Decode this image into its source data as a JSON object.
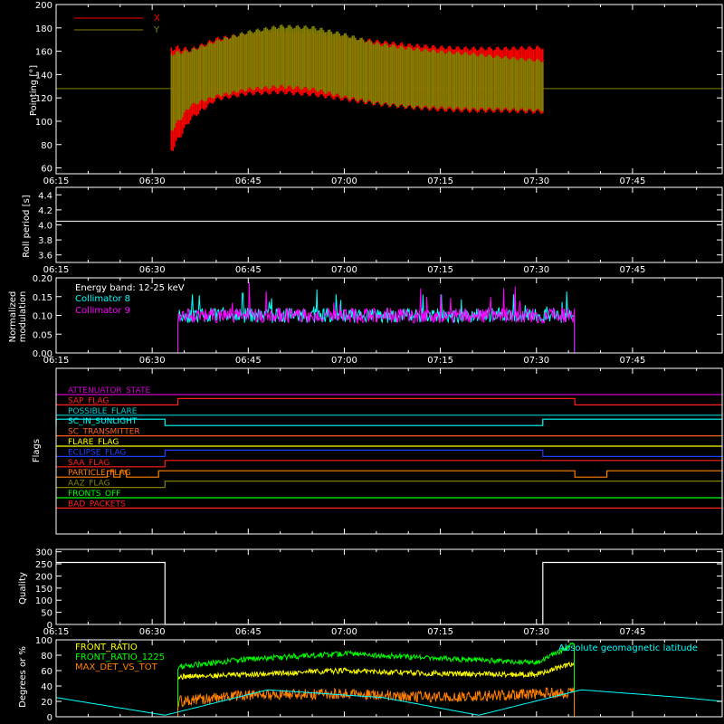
{
  "panels": {
    "pointing": {
      "ylabel": "Pointing [°]",
      "legend": [
        {
          "label": "X",
          "color": "#ff0000"
        },
        {
          "label": "Y",
          "color": "#808000"
        }
      ]
    },
    "roll": {
      "ylabel": "Roll period [s]"
    },
    "modulation": {
      "ylabel_lines": [
        "Normalized",
        "modulation"
      ],
      "annotations": [
        "Energy band: 12-25 keV"
      ],
      "legend": [
        {
          "label": "Collimator 8",
          "color": "#00ffff"
        },
        {
          "label": "Collimator 9",
          "color": "#ff00ff"
        }
      ]
    },
    "flags": {
      "ylabel": "Flags"
    },
    "quality": {
      "ylabel": "Quality"
    },
    "ratios": {
      "ylabel": "Degrees or %",
      "legend": [
        {
          "label": "FRONT_RATIO",
          "color": "#ffff00"
        },
        {
          "label": "FRONT_RATIO_1225",
          "color": "#00ff00"
        },
        {
          "label": "MAX_DET_VS_TOT",
          "color": "#ff8000"
        }
      ],
      "annotation": {
        "label": "Absolute geomagnetic latitude",
        "color": "#00ffff"
      }
    }
  },
  "chart_data": [
    {
      "type": "line",
      "id": "pointing",
      "ylabel": "Pointing [°]",
      "x_range": [
        "06:15",
        "07:59"
      ],
      "x_ticks": [
        "06:15",
        "06:30",
        "06:45",
        "07:00",
        "07:15",
        "07:30",
        "07:45"
      ],
      "ylim": [
        55,
        200
      ],
      "y_ticks": [
        60,
        80,
        100,
        120,
        140,
        160,
        180,
        200
      ],
      "baseline": 128,
      "data_window": [
        "06:33",
        "07:31"
      ],
      "series": [
        {
          "name": "X",
          "color": "#ff0000",
          "envelope_x": [
            "06:33",
            "06:36",
            "06:40",
            "06:45",
            "06:50",
            "06:55",
            "07:00",
            "07:05",
            "07:10",
            "07:15",
            "07:20",
            "07:25",
            "07:31"
          ],
          "envelope_max": [
            166,
            163,
            172,
            177,
            179,
            178,
            174,
            170,
            167,
            165,
            164,
            164,
            165
          ],
          "envelope_min": [
            72,
            100,
            117,
            122,
            123,
            121,
            117,
            113,
            110,
            108,
            107,
            107,
            106
          ]
        },
        {
          "name": "Y",
          "color": "#808000",
          "envelope_x": [
            "06:33",
            "06:36",
            "06:40",
            "06:45",
            "06:50",
            "06:55",
            "07:00",
            "07:05",
            "07:10",
            "07:15",
            "07:20",
            "07:25",
            "07:31"
          ],
          "envelope_max": [
            160,
            162,
            170,
            178,
            183,
            182,
            176,
            168,
            164,
            161,
            159,
            156,
            153
          ],
          "envelope_min": [
            90,
            112,
            120,
            126,
            128,
            126,
            119,
            114,
            111,
            110,
            109,
            109,
            108
          ]
        }
      ]
    },
    {
      "type": "line",
      "id": "roll",
      "ylabel": "Roll period [s]",
      "x_range": [
        "06:15",
        "07:59"
      ],
      "ylim": [
        3.5,
        4.5
      ],
      "y_ticks": [
        3.6,
        3.8,
        4.0,
        4.2,
        4.4
      ],
      "series": [
        {
          "color": "#ffffff",
          "x": [
            "06:15",
            "07:59"
          ],
          "y": [
            4.05,
            4.05
          ]
        }
      ]
    },
    {
      "type": "line",
      "id": "modulation",
      "ylabel": "Normalized modulation",
      "x_range": [
        "06:15",
        "07:59"
      ],
      "ylim": [
        0.0,
        0.2
      ],
      "y_ticks": [
        0.0,
        0.05,
        0.1,
        0.15,
        0.2
      ],
      "annotation": "Energy band: 12-25 keV",
      "data_window": [
        "06:34",
        "07:36"
      ],
      "series": [
        {
          "name": "Collimator 8",
          "color": "#00ffff",
          "typical_range": [
            0.08,
            0.12
          ],
          "max": 0.17
        },
        {
          "name": "Collimator 9",
          "color": "#ff00ff",
          "typical_range": [
            0.08,
            0.12
          ],
          "max": 0.19
        }
      ]
    },
    {
      "type": "line",
      "id": "flags",
      "ylabel": "Flags",
      "x_range": [
        "06:15",
        "07:59"
      ],
      "series": [
        {
          "name": "ATTENUATOR_STATE",
          "color": "#cc00cc",
          "steps": []
        },
        {
          "name": "SAP_FLAG",
          "color": "#ff2020",
          "steps": [
            [
              "06:15",
              0
            ],
            [
              "06:34",
              1
            ],
            [
              "07:36",
              0
            ]
          ]
        },
        {
          "name": "POSSIBLE_FLARE",
          "color": "#00cccc",
          "steps": []
        },
        {
          "name": "SC_IN_SUNLIGHT",
          "color": "#00ffff",
          "steps": [
            [
              "06:15",
              1
            ],
            [
              "06:32",
              0
            ],
            [
              "07:31",
              1
            ]
          ]
        },
        {
          "name": "SC_TRANSMITTER",
          "color": "#ff6020",
          "steps": []
        },
        {
          "name": "FLARE_FLAG",
          "color": "#ffff00",
          "steps": []
        },
        {
          "name": "ECLIPSE_FLAG",
          "color": "#2040ff",
          "steps": [
            [
              "06:15",
              0
            ],
            [
              "06:32",
              1
            ],
            [
              "07:31",
              0
            ]
          ]
        },
        {
          "name": "SAA_FLAG",
          "color": "#ff2020",
          "steps": [
            [
              "06:15",
              0
            ],
            [
              "06:32",
              1
            ]
          ]
        },
        {
          "name": "PARTICLE_FLAG",
          "color": "#ff8000",
          "steps": [
            [
              "06:15",
              0
            ],
            [
              "06:16",
              0
            ],
            [
              "06:23",
              1
            ],
            [
              "06:24",
              0
            ],
            [
              "06:25",
              1
            ],
            [
              "06:26",
              0
            ],
            [
              "06:31",
              1
            ],
            [
              "07:36",
              0
            ],
            [
              "07:41",
              1
            ],
            [
              "07:47",
              1
            ]
          ]
        },
        {
          "name": "AAZ_FLAG",
          "color": "#808000",
          "steps": [
            [
              "06:32",
              1
            ],
            [
              "07:31",
              1
            ]
          ]
        },
        {
          "name": "FRONTS_OFF",
          "color": "#00ff00",
          "steps": []
        },
        {
          "name": "BAD_PACKETS",
          "color": "#ff2020",
          "steps": []
        }
      ]
    },
    {
      "type": "line",
      "id": "quality",
      "ylabel": "Quality",
      "x_range": [
        "06:15",
        "07:59"
      ],
      "ylim": [
        0,
        310
      ],
      "y_ticks": [
        0,
        50,
        100,
        150,
        200,
        250,
        300
      ],
      "series": [
        {
          "color": "#ffffff",
          "x": [
            "06:15",
            "06:32",
            "06:32",
            "07:31",
            "07:31",
            "07:59"
          ],
          "y": [
            256,
            256,
            0,
            0,
            256,
            256
          ]
        }
      ]
    },
    {
      "type": "line",
      "id": "ratios",
      "ylabel": "Degrees or %",
      "x_range": [
        "06:15",
        "07:59"
      ],
      "ylim": [
        0,
        100
      ],
      "y_ticks": [
        0,
        20,
        40,
        60,
        80,
        100
      ],
      "series": [
        {
          "name": "FRONT_RATIO",
          "color": "#ffff00",
          "x": [
            "06:34",
            "06:45",
            "07:00",
            "07:15",
            "07:30",
            "07:36"
          ],
          "y": [
            52,
            55,
            60,
            56,
            55,
            70
          ]
        },
        {
          "name": "FRONT_RATIO_1225",
          "color": "#00ff00",
          "x": [
            "06:34",
            "06:45",
            "07:00",
            "07:15",
            "07:30",
            "07:36"
          ],
          "y": [
            65,
            75,
            82,
            76,
            70,
            95
          ]
        },
        {
          "name": "MAX_DET_VS_TOT",
          "color": "#ff8000",
          "x": [
            "06:34",
            "06:45",
            "07:00",
            "07:15",
            "07:30",
            "07:36"
          ],
          "y": [
            20,
            28,
            30,
            25,
            30,
            32
          ]
        },
        {
          "name": "Absolute geomagnetic latitude",
          "color": "#00ffff",
          "x": [
            "06:15",
            "06:32",
            "06:48",
            "07:06",
            "07:21",
            "07:37",
            "07:53",
            "07:59"
          ],
          "y": [
            25,
            2,
            35,
            25,
            2,
            35,
            25,
            20
          ]
        }
      ]
    }
  ]
}
